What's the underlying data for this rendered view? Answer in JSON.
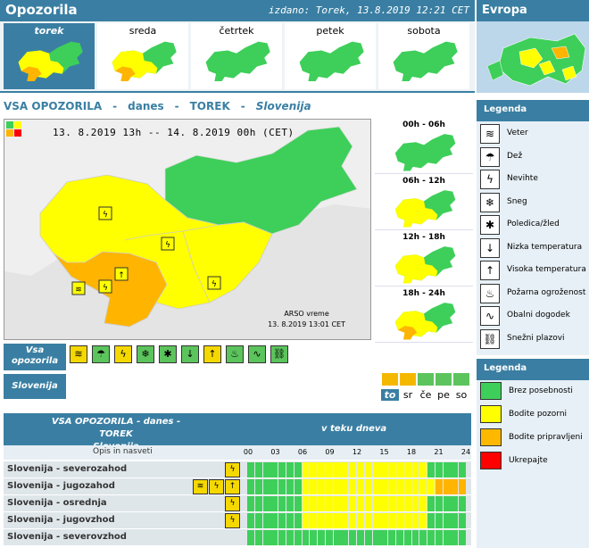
{
  "header": {
    "title": "Opozorila",
    "issued": "izdano: Torek, 13.8.2019 12:21 CET",
    "europa": "Evropa"
  },
  "days": [
    {
      "label": "torek",
      "selected": true
    },
    {
      "label": "sreda",
      "selected": false
    },
    {
      "label": "četrtek",
      "selected": false
    },
    {
      "label": "petek",
      "selected": false
    },
    {
      "label": "sobota",
      "selected": false
    }
  ],
  "main": {
    "t1": "VSA OPOZORILA",
    "t2": "danes",
    "t3": "TOREK",
    "t4": "Slovenija",
    "sep": "-",
    "period": "13. 8.2019 13h -- 14. 8.2019 00h (CET)",
    "arso1": "ARSO vreme",
    "arso2": "13. 8.2019 13:01 CET"
  },
  "slots": [
    "00h - 06h",
    "06h - 12h",
    "12h - 18h",
    "18h - 24h"
  ],
  "iconbar": {
    "vsa": "Vsa opozorila",
    "slovenija": "Slovenija",
    "icons": [
      {
        "name": "wind-icon",
        "glyph": "≋",
        "level": "y"
      },
      {
        "name": "rain-icon",
        "glyph": "☂",
        "level": "g"
      },
      {
        "name": "thunder-icon",
        "glyph": "ϟ",
        "level": "y"
      },
      {
        "name": "snow-icon",
        "glyph": "❄",
        "level": "g"
      },
      {
        "name": "ice-icon",
        "glyph": "✱",
        "level": "g"
      },
      {
        "name": "low-temp-icon",
        "glyph": "↓",
        "level": "g"
      },
      {
        "name": "high-temp-icon",
        "glyph": "↑",
        "level": "y"
      },
      {
        "name": "fire-icon",
        "glyph": "♨",
        "level": "g"
      },
      {
        "name": "coast-icon",
        "glyph": "∿",
        "level": "g"
      },
      {
        "name": "avalanche-icon",
        "glyph": "⛓",
        "level": "g"
      }
    ]
  },
  "day_short": [
    "to",
    "sr",
    "če",
    "pe",
    "so"
  ],
  "day_short_colors": [
    "#f5b800",
    "#f5b800",
    "#5cc45c",
    "#5cc45c",
    "#5cc45c"
  ],
  "table": {
    "h1a": "VSA OPOZORILA - danes - TOREK",
    "h1b": "Slovenija",
    "h2": "v teku dneva",
    "opis": "Opis in nasveti",
    "ticks": [
      "00",
      "03",
      "06",
      "09",
      "12",
      "15",
      "18",
      "21",
      "24"
    ],
    "rows": [
      {
        "label": "Slovenija - severozahod",
        "icons": [
          "ϟ"
        ],
        "cells": "gggggggyyyyyyyyyyyyyyyyggggg"
      },
      {
        "label": "Slovenija - jugozahod",
        "icons": [
          "≋",
          "ϟ",
          "↑"
        ],
        "cells": "gggggggyyyyyyyyyyyyyyyyyoooo"
      },
      {
        "label": "Slovenija - osrednja",
        "icons": [
          "ϟ"
        ],
        "cells": "gggggggyyyyyyyyyyyyyyyyggggg"
      },
      {
        "label": "Slovenija - jugovzhod",
        "icons": [
          "ϟ"
        ],
        "cells": "gggggggyyyyyyyyyyyyyyyyggggg"
      },
      {
        "label": "Slovenija - severovzhod",
        "icons": [],
        "cells": "gggggggggggggggggggggggggggg"
      }
    ]
  },
  "legend1": {
    "title": "Legenda",
    "items": [
      {
        "name": "wind-icon",
        "glyph": "≋",
        "label": "Veter"
      },
      {
        "name": "rain-icon",
        "glyph": "☂",
        "label": "Dež"
      },
      {
        "name": "thunder-icon",
        "glyph": "ϟ",
        "label": "Nevihte"
      },
      {
        "name": "snow-icon",
        "glyph": "❄",
        "label": "Sneg"
      },
      {
        "name": "ice-icon",
        "glyph": "✱",
        "label": "Poledica/žled"
      },
      {
        "name": "low-temp-icon",
        "glyph": "↓",
        "label": "Nizka temperatura"
      },
      {
        "name": "high-temp-icon",
        "glyph": "↑",
        "label": "Visoka temperatura"
      },
      {
        "name": "fire-icon",
        "glyph": "♨",
        "label": "Požarna ogroženost"
      },
      {
        "name": "coast-icon",
        "glyph": "∿",
        "label": "Obalni dogodek"
      },
      {
        "name": "avalanche-icon",
        "glyph": "⛓",
        "label": "Snežni plazovi"
      }
    ]
  },
  "legend2": {
    "title": "Legenda",
    "items": [
      {
        "color": "#3ecf5a",
        "label": "Brez posebnosti"
      },
      {
        "color": "#ffff00",
        "label": "Bodite pozorni"
      },
      {
        "color": "#ffb800",
        "label": "Bodite pripravljeni"
      },
      {
        "color": "#ff0000",
        "label": "Ukrepajte"
      }
    ]
  },
  "colors": {
    "g": "#3ecf5a",
    "y": "#ffff00",
    "o": "#ffb400",
    "r": "#ff0000",
    "accent": "#3a7fa3"
  }
}
